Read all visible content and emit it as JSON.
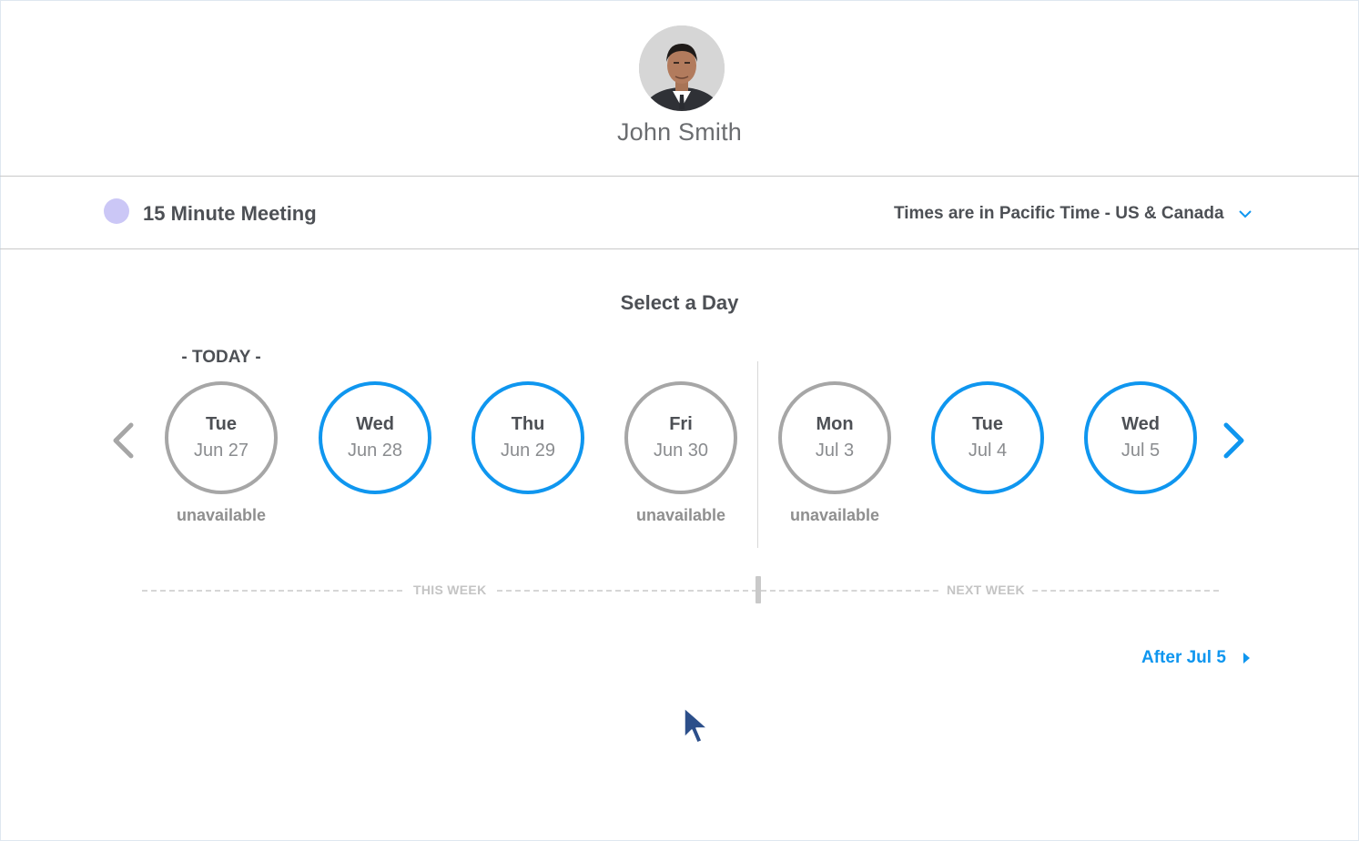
{
  "profile": {
    "name": "John Smith"
  },
  "event": {
    "title": "15 Minute Meeting",
    "dot_color": "#cbc7f6"
  },
  "timezone": {
    "label": "Times are in Pacific Time - US & Canada",
    "icon": "chevron-down-icon"
  },
  "calendar": {
    "heading": "Select a Day",
    "today_label": "- TODAY -",
    "prev_icon": "chevron-left-icon",
    "next_icon": "chevron-right-icon",
    "days": [
      {
        "weekday": "Tue",
        "date": "Jun 27",
        "available": false,
        "note": "unavailable"
      },
      {
        "weekday": "Wed",
        "date": "Jun 28",
        "available": true,
        "note": ""
      },
      {
        "weekday": "Thu",
        "date": "Jun 29",
        "available": true,
        "note": ""
      },
      {
        "weekday": "Fri",
        "date": "Jun 30",
        "available": false,
        "note": "unavailable"
      },
      {
        "weekday": "Mon",
        "date": "Jul 3",
        "available": false,
        "note": "unavailable"
      },
      {
        "weekday": "Tue",
        "date": "Jul 4",
        "available": true,
        "note": ""
      },
      {
        "weekday": "Wed",
        "date": "Jul 5",
        "available": true,
        "note": ""
      }
    ],
    "weeks": {
      "this_week": "THIS WEEK",
      "next_week": "NEXT WEEK"
    },
    "after_link": "After Jul 5"
  },
  "colors": {
    "accent": "#0f96ef",
    "unavailable_ring": "#a6a6a6",
    "text": "#4d5055"
  }
}
